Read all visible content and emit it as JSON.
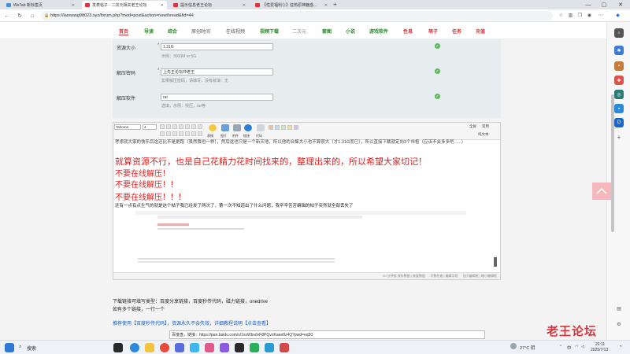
{
  "tabs": [
    {
      "label": "WeTab 新标签页",
      "color": "#4a90d9",
      "active": false
    },
    {
      "label": "发表帖子 - 二次元相关老王论坛",
      "color": "#d9343c",
      "active": true
    },
    {
      "label": "提示信息老王论坛",
      "color": "#d9343c",
      "active": false
    },
    {
      "label": "【性爱福利②】狂热原神魅惑...",
      "color": "#d9343c",
      "active": false
    }
  ],
  "browser": {
    "url": "https://laowang98023.xyz/forum.php?mod=post&action=newthread&fid=44",
    "new_tab": "+",
    "min": "—",
    "max": "▢",
    "close": "✕"
  },
  "site_nav": [
    {
      "label": "首页",
      "color": "#d9343c"
    },
    {
      "label": "导读",
      "color": "#2a8c2a"
    },
    {
      "label": "综合",
      "color": "#2a8c2a"
    },
    {
      "label": "原创时间",
      "color": "#555"
    },
    {
      "label": "在线视频",
      "color": "#555"
    },
    {
      "label": "视频下载",
      "color": "#2a8c2a"
    },
    {
      "label": "二次元",
      "color": "#888"
    },
    {
      "label": "套图",
      "color": "#2a8c2a"
    },
    {
      "label": "小说",
      "color": "#2a8c2a"
    },
    {
      "label": "游戏软件",
      "color": "#2a8c2a"
    },
    {
      "label": "性息",
      "color": "#d9343c"
    },
    {
      "label": "萌子",
      "color": "#d9343c"
    },
    {
      "label": "任务",
      "color": "#d9343c"
    },
    {
      "label": "充值",
      "color": "#d9343c"
    }
  ],
  "form": {
    "size": {
      "label": "资源大小",
      "value": "1.31G",
      "hint": "示例：3000M or 5G"
    },
    "password": {
      "label": "解压密码",
      "value": "上先王论坛冲老王",
      "hint": "如果解压密码，请填写，没有就填：无"
    },
    "software": {
      "label": "解压软件",
      "value": "rar",
      "hint": "选填，示例：快压，rar等"
    },
    "required_mark": "*"
  },
  "editor": {
    "font": "Tahoma",
    "size": "4",
    "tool_labels": [
      "表情",
      "图片",
      "附件",
      "链接",
      "代码"
    ],
    "right_labels": [
      "全屏",
      "常用",
      "纯文本"
    ],
    "line1": "考虑就大家的快乐后这还比不是更跑（虽然我也一样），然后这也只是一个新天地，所以他的合集大小也不算很大（才1.31G而已），所以直接下载就定向3个市枢（应该不会多多吧......）",
    "line2": "就算资源不行，也是自己花精力花时间找来的，整理出来的，所以希望大家切记！",
    "line3": "不要在线解压！",
    "line4": "不要在线解压！！",
    "line5": "不要在线解压！！！",
    "line6": "还有一点有点生气的就是这个帖子我已经发了两次了，第一次不知道出了什么问题，我辛辛苦苦编辑的帖子突然就全部丢失了",
    "status": "20 分钟前 保存数据 | 恢复数据 　 字数检查 | 编辑字段 　 加大编辑框 | 缩小编辑框"
  },
  "lower": {
    "download_line": "下载链接可填写类型：百度分享链接，百度秒传代码，磁力链接，onedrive",
    "multi_line": "如有多个链接，一行一个",
    "recommend": "推荐使用【百度秒传代码】，资源永久不会失效，详细教程说明【点击查看】",
    "link_value": "百度盘，链接：https://pan.baidu.com/s/1xsWbsdvF8PQvnKaee8z4Q?pwd=eq50"
  },
  "taskbar": {
    "search": "搜索",
    "weather": "27°C 阴",
    "lang": "中",
    "time": "22:11",
    "date": "2025/7/13"
  },
  "watermark": "老王论坛",
  "icons": {
    "back": "arrow-left-icon",
    "refresh": "refresh-icon",
    "home": "home-icon"
  }
}
